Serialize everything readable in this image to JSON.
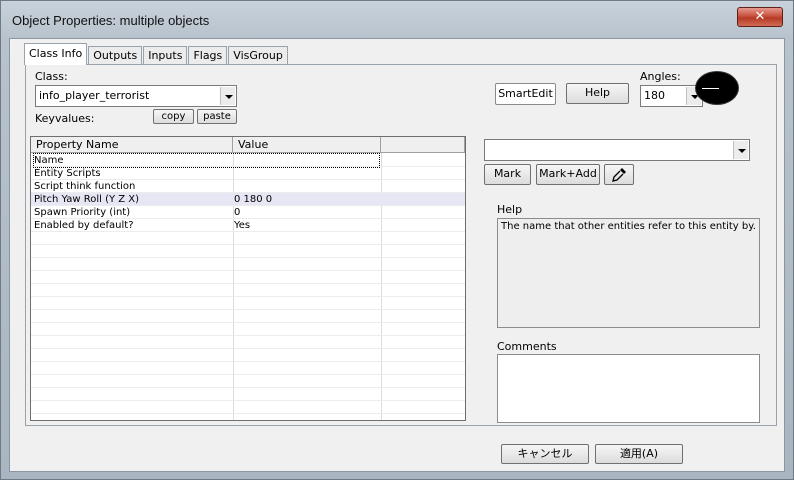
{
  "window": {
    "title": "Object Properties: multiple objects",
    "close_label": "✕"
  },
  "tabs": [
    {
      "label": "Class Info"
    },
    {
      "label": "Outputs"
    },
    {
      "label": "Inputs"
    },
    {
      "label": "Flags"
    },
    {
      "label": "VisGroup"
    }
  ],
  "class_info": {
    "class_label": "Class:",
    "class_value": "info_player_terrorist",
    "keyvalues_label": "Keyvalues:",
    "copy_label": "copy",
    "paste_label": "paste",
    "smartedit_label": "SmartEdit",
    "help_button_label": "Help",
    "angles_label": "Angles:",
    "angles_value": "180"
  },
  "table": {
    "columns": [
      "Property Name",
      "Value"
    ],
    "rows": [
      {
        "name": "Name",
        "value": ""
      },
      {
        "name": "Entity Scripts",
        "value": ""
      },
      {
        "name": "Script think function",
        "value": ""
      },
      {
        "name": "Pitch Yaw Roll (Y Z X)",
        "value": "0 180 0"
      },
      {
        "name": "Spawn Priority (int)",
        "value": "0"
      },
      {
        "name": "Enabled by default?",
        "value": "Yes"
      }
    ]
  },
  "right_panel": {
    "value_combo": "",
    "mark_label": "Mark",
    "mark_add_label": "Mark+Add",
    "help_label": "Help",
    "help_text": "The name that other entities refer to this entity by.",
    "comments_label": "Comments",
    "comments_value": ""
  },
  "footer": {
    "cancel_label": "キャンセル",
    "apply_label": "適用(A)"
  }
}
